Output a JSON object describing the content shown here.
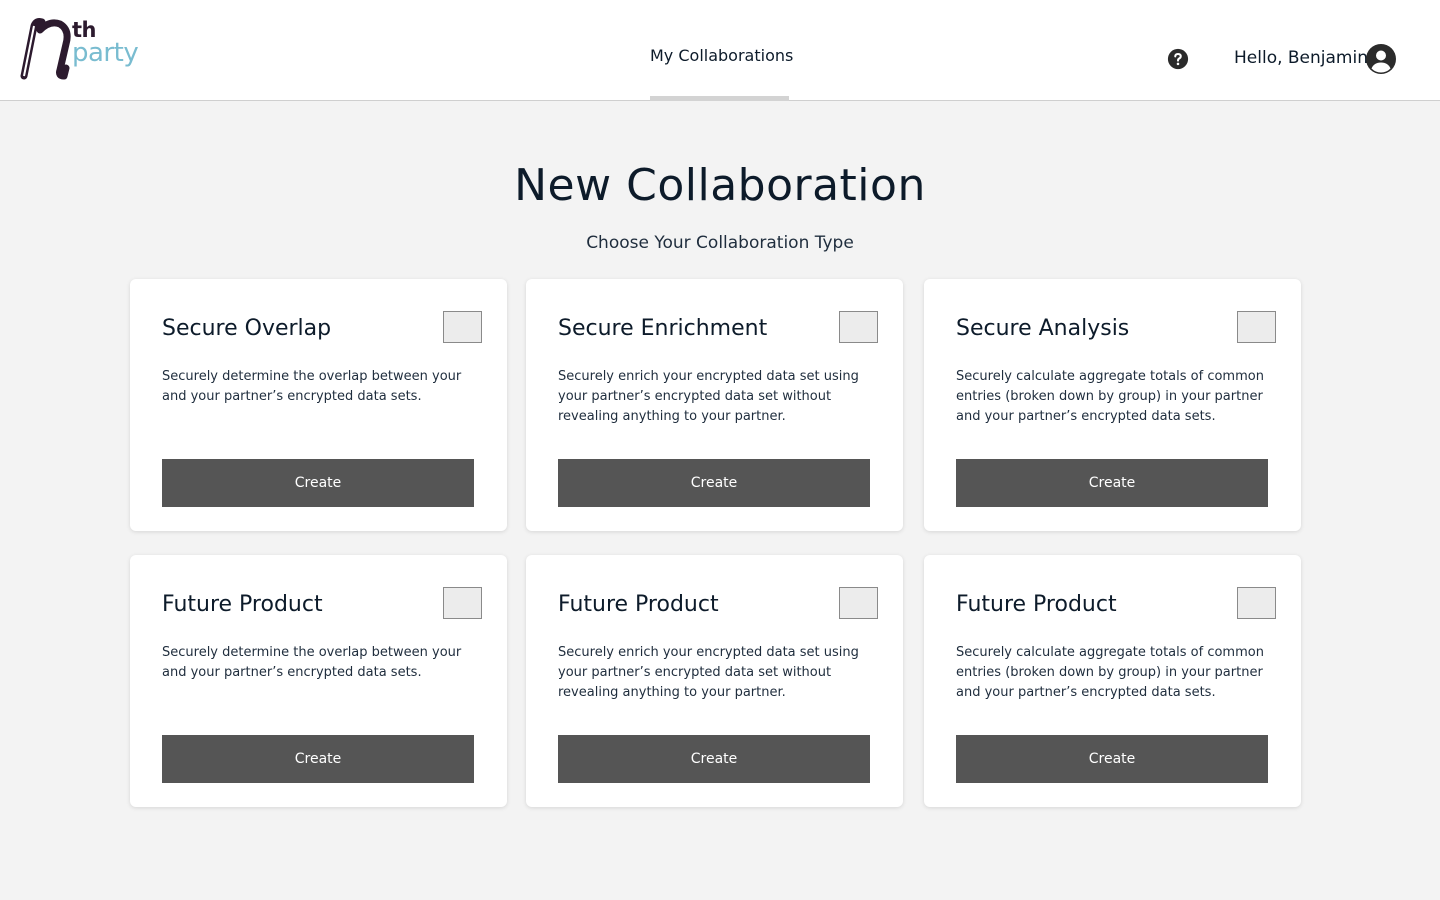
{
  "header": {
    "logo": {
      "superscript": "th",
      "word": "party",
      "colors": {
        "dark": "#2c1a2e",
        "light": "#79bcd0"
      }
    },
    "nav_tab_label": "My Collaborations",
    "help_icon": "help-circle-icon",
    "greeting": "Hello, Benjamin",
    "avatar_icon": "user-circle-icon"
  },
  "main": {
    "title": "New Collaboration",
    "subtitle": "Choose Your Collaboration Type",
    "cards": [
      {
        "title": "Secure Overlap",
        "description": "Securely determine the overlap between your and your partner’s encrypted data sets.",
        "button_label": "Create"
      },
      {
        "title": "Secure Enrichment",
        "description": "Securely enrich your encrypted data set using your partner’s encrypted data set without revealing anything to your partner.",
        "button_label": "Create"
      },
      {
        "title": "Secure Analysis",
        "description": "Securely calculate aggregate totals of common entries (broken down by group) in your partner and your partner’s encrypted data sets.",
        "button_label": "Create"
      },
      {
        "title": "Future Product",
        "description": "Securely determine the overlap between your and your partner’s encrypted data sets.",
        "button_label": "Create"
      },
      {
        "title": "Future Product",
        "description": "Securely enrich your encrypted data set using your partner’s encrypted data set without revealing anything to your partner.",
        "button_label": "Create"
      },
      {
        "title": "Future Product",
        "description": "Securely calculate aggregate totals of common entries (broken down by group) in your partner and your partner’s encrypted data sets.",
        "button_label": "Create"
      }
    ]
  },
  "colors": {
    "background": "#f3f3f3",
    "card": "#ffffff",
    "button": "#555555",
    "text": "#0d1b2a",
    "tab_indicator": "#d3d3d3"
  }
}
